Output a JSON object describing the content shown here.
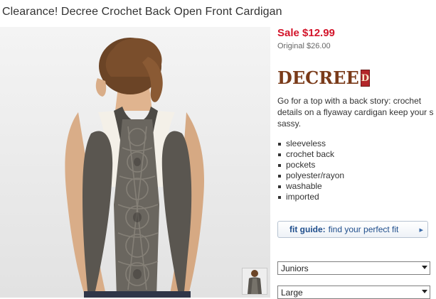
{
  "product": {
    "title": "Clearance! Decree Crochet Back Open Front Cardigan",
    "sale_price": "Sale $12.99",
    "original_price": "Original $26.00",
    "brand": "Decree",
    "brand_wordmark": "DECREE",
    "description_lines": [
      "Go for a top with a back story: crochet",
      "details on a flyaway cardigan keep your s",
      "sassy."
    ],
    "features": [
      "sleeveless",
      "crochet back",
      "pockets",
      "polyester/rayon",
      "washable",
      "imported"
    ]
  },
  "fit_guide": {
    "bold": "fit guide:",
    "text": "find your perfect fit",
    "arrow": "▸"
  },
  "selects": {
    "size_range": "Juniors",
    "size": "Large"
  },
  "colors": {
    "sale": "#d3152b",
    "brand": "#7a3b1a",
    "link": "#1f4e8c",
    "garment": "#5a5650"
  }
}
